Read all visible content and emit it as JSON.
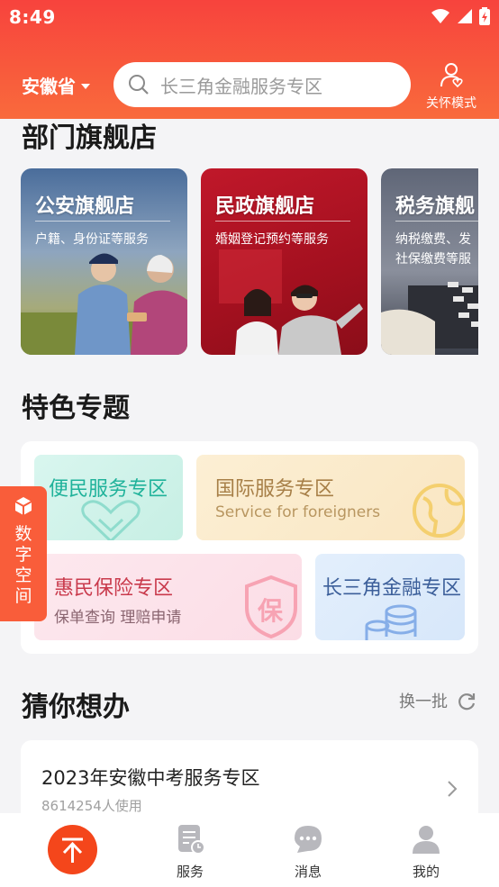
{
  "status_bar": {
    "time": "8:49"
  },
  "header": {
    "province": "安徽省",
    "search_placeholder": "长三角金融服务专区",
    "care_mode_label": "关怀模式"
  },
  "flagship": {
    "title": "部门旗舰店",
    "stores": [
      {
        "title": "公安旗舰店",
        "subtitle": "户籍、身份证等服务"
      },
      {
        "title": "民政旗舰店",
        "subtitle": "婚姻登记预约等服务"
      },
      {
        "title": "税务旗舰",
        "subtitle": "纳税缴费、发 社保缴费等服"
      }
    ]
  },
  "topics": {
    "title": "特色专题",
    "items": [
      {
        "title": "便民服务专区"
      },
      {
        "title": "国际服务专区",
        "subtitle": "Service  for foreigners"
      },
      {
        "title": "惠民保险专区",
        "subtitle": "保单查询 理赔申请",
        "badge": "保"
      },
      {
        "title": "长三角金融专区"
      }
    ]
  },
  "guess": {
    "title": "猜你想办",
    "refresh_label": "换一批",
    "items": [
      {
        "title": "2023年安徽中考服务专区",
        "usage": "8614254人使用"
      }
    ]
  },
  "floating_tab": {
    "label": "数字空间"
  },
  "bottom_nav": {
    "items": [
      {
        "label": "服务"
      },
      {
        "label": "消息"
      },
      {
        "label": "我的"
      }
    ]
  },
  "colors": {
    "brand": "#f7433d",
    "brand_orange": "#f96a3c",
    "float_tab": "#f95d3a",
    "home_button": "#f4461b"
  }
}
